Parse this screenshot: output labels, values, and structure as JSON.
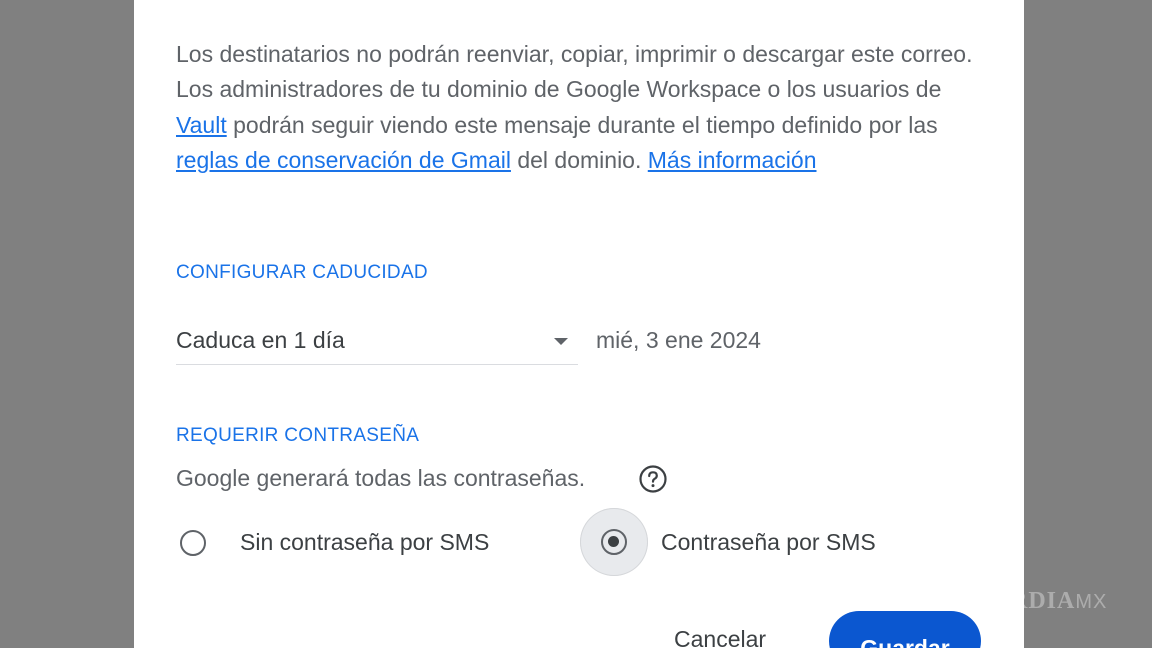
{
  "description": {
    "part1": "Los destinatarios no podrán reenviar, copiar, imprimir o descargar este correo. Los administradores de tu dominio de Google Workspace o los usuarios de ",
    "link_vault": "Vault",
    "part2": " podrán seguir viendo este mensaje durante el tiempo definido por las ",
    "link_rules": "reglas de conservación de Gmail",
    "part3": " del dominio. ",
    "link_more": "Más información"
  },
  "expiration": {
    "section_label": "CONFIGURAR CADUCIDAD",
    "selected": "Caduca en 1 día",
    "date": "mié, 3 ene 2024"
  },
  "password": {
    "section_label": "REQUERIR CONTRASEÑA",
    "hint": "Google generará todas las contraseñas.",
    "options": [
      {
        "label": "Sin contraseña por SMS",
        "selected": false
      },
      {
        "label": "Contraseña por SMS",
        "selected": true
      }
    ]
  },
  "actions": {
    "cancel": "Cancelar",
    "save": "Guardar"
  },
  "watermark": {
    "brand": "RDIA",
    "suffix": "MX"
  },
  "colors": {
    "accent": "#1a73e8",
    "primary_button": "#0b57d0",
    "overlay": "#808080",
    "text": "#3c4043",
    "muted_text": "#5f6368"
  },
  "icons": {
    "help": "help-circle-icon",
    "dropdown": "caret-down-icon"
  }
}
